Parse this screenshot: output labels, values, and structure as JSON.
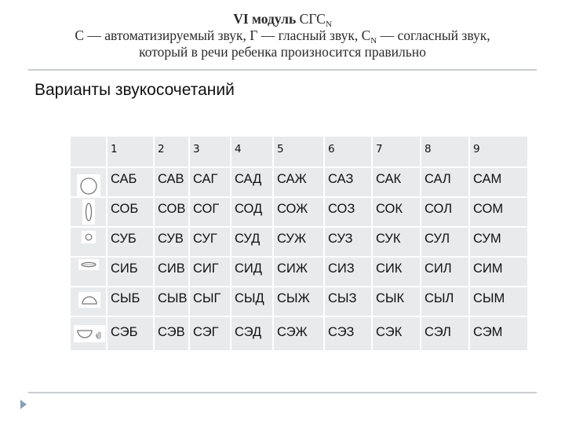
{
  "header": {
    "title_bold": "VI модуль",
    "title_rest": "СГС",
    "title_sub": "N",
    "line2_a": "С — автоматизируемый звук, Г — гласный звук, С",
    "line2_sub": "N",
    "line2_b": " — согласный звук,",
    "line3": "который в речи ребенка произносится правильно"
  },
  "subtitle": "Варианты звукосочетаний",
  "table": {
    "columns": [
      "",
      "1",
      "2",
      "3",
      "4",
      "5",
      "6",
      "7",
      "8",
      "9"
    ],
    "rows": [
      {
        "icon": "lips-round-wide-icon",
        "cells": [
          "САБ",
          "САВ",
          "САГ",
          "САД",
          "САЖ",
          "САЗ",
          "САК",
          "САЛ",
          "САМ"
        ]
      },
      {
        "icon": "lips-oval-narrow-icon",
        "cells": [
          "СОБ",
          "СОВ",
          "СОГ",
          "СОД",
          "СОЖ",
          "СОЗ",
          "СОК",
          "СОЛ",
          "СОМ"
        ]
      },
      {
        "icon": "lips-small-circle-icon",
        "cells": [
          "СУБ",
          "СУВ",
          "СУГ",
          "СУД",
          "СУЖ",
          "СУЗ",
          "СУК",
          "СУЛ",
          "СУМ"
        ]
      },
      {
        "icon": "lips-flat-smile-icon",
        "cells": [
          "СИБ",
          "СИВ",
          "СИГ",
          "СИД",
          "СИЖ",
          "СИЗ",
          "СИК",
          "СИЛ",
          "СИМ"
        ]
      },
      {
        "icon": "lips-half-dome-icon",
        "cells": [
          "СЫБ",
          "СЫВ",
          "СЫГ",
          "СЫД",
          "СЫЖ",
          "СЫЗ",
          "СЫК",
          "СЫЛ",
          "СЫМ"
        ]
      },
      {
        "icon": "lips-half-bowl-with-hand-icon",
        "cells": [
          "СЭБ",
          "СЭВ",
          "СЭГ",
          "СЭД",
          "СЭЖ",
          "СЭЗ",
          "СЭК",
          "СЭЛ",
          "СЭМ"
        ]
      }
    ]
  }
}
